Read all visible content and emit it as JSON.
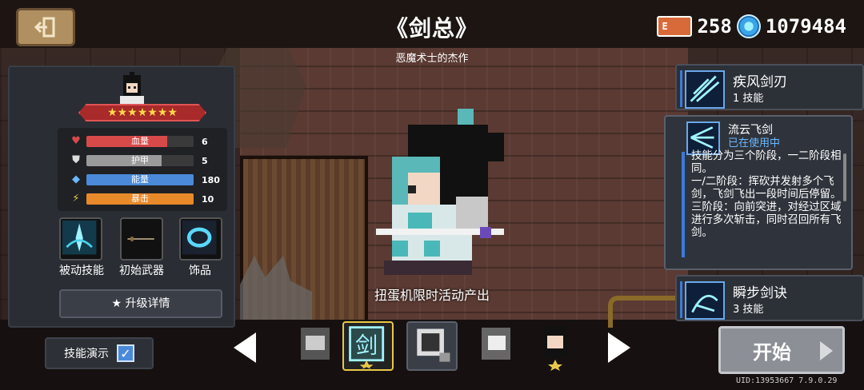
{
  "header": {
    "back_icon": "exit-door-icon",
    "title": "《剑总》",
    "subtitle": "恶魔术士的杰作"
  },
  "currency": {
    "energy_icon_label": "E",
    "energy": "258",
    "gems": "1079484"
  },
  "stats": [
    {
      "label": "血量",
      "value": "6",
      "fill": 0.75,
      "color": "#d84a4a",
      "icon": "heart-icon"
    },
    {
      "label": "护甲",
      "value": "5",
      "fill": 0.7,
      "color": "#9a9a9a",
      "icon": "shield-icon"
    },
    {
      "label": "能量",
      "value": "180",
      "fill": 1.0,
      "color": "#4a8ad8",
      "icon": "energy-crystal-icon"
    },
    {
      "label": "暴击",
      "value": "10",
      "fill": 1.0,
      "color": "#e88a2a",
      "icon": "crit-icon"
    }
  ],
  "slots": [
    {
      "label": "被动技能",
      "icon": "passive-skill-icon"
    },
    {
      "label": "初始武器",
      "icon": "sword-weapon-icon"
    },
    {
      "label": "饰品",
      "icon": "ring-accessory-icon"
    }
  ],
  "upgrade_label": "★ 升级详情",
  "demo": {
    "label": "技能演示",
    "checked": true
  },
  "drop_text": "扭蛋机限时活动产出",
  "skills": {
    "skill1": {
      "name": "疾风剑刃",
      "sub": "1 技能"
    },
    "active": {
      "name": "流云飞剑",
      "status": "已在使用中",
      "desc": "技能分为三个阶段，一二阶段相同。\n一/二阶段：挥砍并发射多个飞剑，飞剑飞出一段时间后停留。\n三阶段：向前突进，对经过区域进行多次斩击，同时召回所有飞剑。"
    },
    "skill3": {
      "name": "瞬步剑诀",
      "sub": "3 技能"
    }
  },
  "start_label": "开始",
  "uid": "UID:13953667 7.9.0.29",
  "colors": {
    "accent": "#4a8ad8",
    "panel": "#2a2d33",
    "star_bar": "#a82a2a"
  }
}
